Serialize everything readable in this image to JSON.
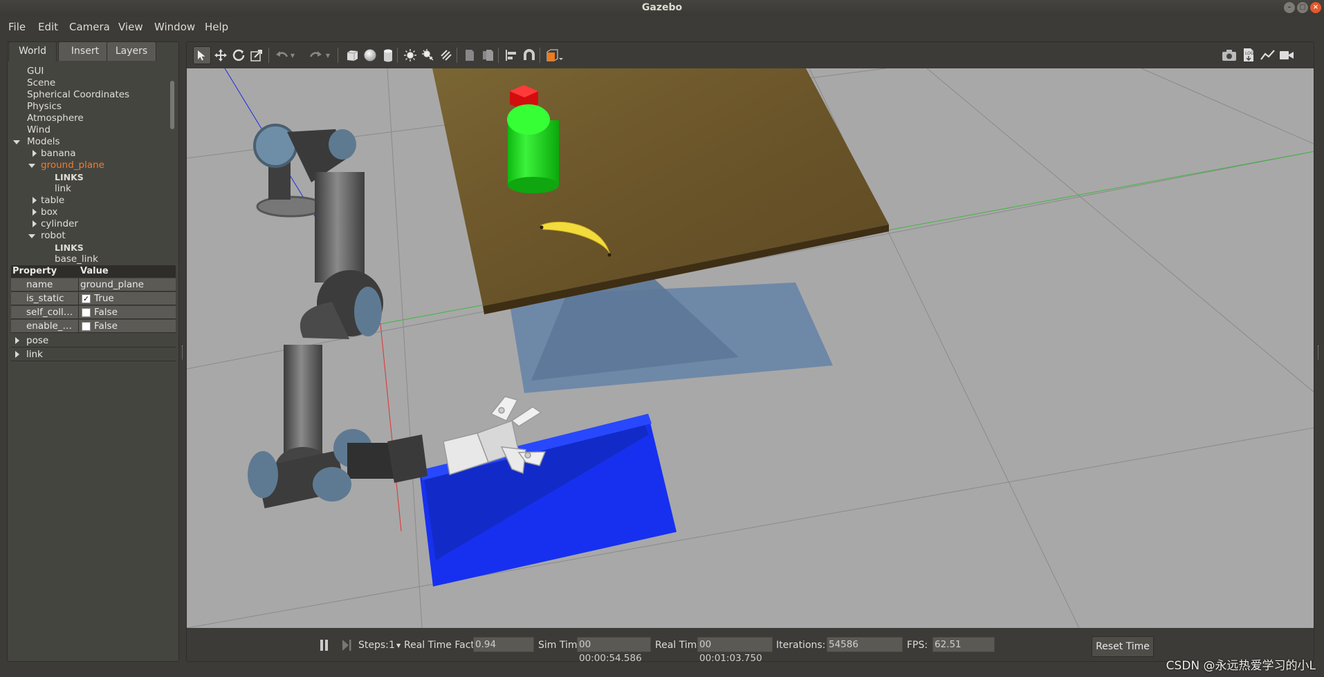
{
  "window": {
    "title": "Gazebo"
  },
  "menubar": {
    "items": [
      "File",
      "Edit",
      "Camera",
      "View",
      "Window",
      "Help"
    ]
  },
  "left_panel": {
    "tabs": [
      "World",
      "Insert",
      "Layers"
    ],
    "active_tab": "World",
    "tree": [
      {
        "label": "GUI",
        "level": 0,
        "expander": "none"
      },
      {
        "label": "Scene",
        "level": 0,
        "expander": "none"
      },
      {
        "label": "Spherical Coordinates",
        "level": 0,
        "expander": "none"
      },
      {
        "label": "Physics",
        "level": 0,
        "expander": "none"
      },
      {
        "label": "Atmosphere",
        "level": 0,
        "expander": "none"
      },
      {
        "label": "Wind",
        "level": 0,
        "expander": "none"
      },
      {
        "label": "Models",
        "level": 0,
        "expander": "open"
      },
      {
        "label": "banana",
        "level": 1,
        "expander": "closed"
      },
      {
        "label": "ground_plane",
        "level": 1,
        "expander": "open",
        "selected": true
      },
      {
        "label": "LINKS",
        "level": 2,
        "expander": "none",
        "bold": true
      },
      {
        "label": "link",
        "level": 2,
        "expander": "none"
      },
      {
        "label": "table",
        "level": 1,
        "expander": "closed"
      },
      {
        "label": "box",
        "level": 1,
        "expander": "closed"
      },
      {
        "label": "cylinder",
        "level": 1,
        "expander": "closed"
      },
      {
        "label": "robot",
        "level": 1,
        "expander": "open"
      },
      {
        "label": "LINKS",
        "level": 2,
        "expander": "none",
        "bold": true
      },
      {
        "label": "base_link",
        "level": 2,
        "expander": "none"
      }
    ],
    "properties": {
      "header": {
        "property": "Property",
        "value": "Value"
      },
      "rows": [
        {
          "name": "name",
          "value": "ground_plane",
          "checkbox": null
        },
        {
          "name": "is_static",
          "value": "True",
          "checkbox": true
        },
        {
          "name": "self_coll…",
          "value": "False",
          "checkbox": false
        },
        {
          "name": "enable_…",
          "value": "False",
          "checkbox": false
        }
      ],
      "groups": [
        "pose",
        "link"
      ]
    }
  },
  "toolbar": {
    "icons": [
      "select-arrow-icon",
      "translate-icon",
      "rotate-icon",
      "scale-icon",
      "undo-icon",
      "undo-dropdown-icon",
      "redo-icon",
      "redo-dropdown-icon",
      "box-shape-icon",
      "sphere-shape-icon",
      "cylinder-shape-icon",
      "point-light-icon",
      "spot-light-icon",
      "directional-light-icon",
      "copy-icon",
      "paste-icon",
      "align-icon",
      "snap-magnet-icon",
      "view-angle-icon"
    ],
    "right_icons": [
      "screenshot-icon",
      "log-icon",
      "plot-icon",
      "video-record-icon"
    ]
  },
  "bottom_bar": {
    "steps_label": "Steps:",
    "steps_value": "1",
    "rtf_label": "Real Time Factor:",
    "rtf_value": "0.94",
    "sim_time_label": "Sim Time:",
    "sim_time_value": "00 00:00:54.586",
    "real_time_label": "Real Time:",
    "real_time_value": "00 00:01:03.750",
    "iterations_label": "Iterations:",
    "iterations_value": "54586",
    "fps_label": "FPS:",
    "fps_value": "62.51",
    "reset_label": "Reset Time"
  },
  "watermark": "CSDN @永远热爱学习的小L",
  "colors": {
    "accent_selected": "#f07c2e",
    "panel_bg": "#454540",
    "viewport_ground": "#a8a8a8",
    "table_wood": "#6e5a2e",
    "box_blue": "#1530f0",
    "cylinder_green": "#18e018",
    "cube_red": "#ee1111",
    "banana_yellow": "#f2dc3c"
  }
}
